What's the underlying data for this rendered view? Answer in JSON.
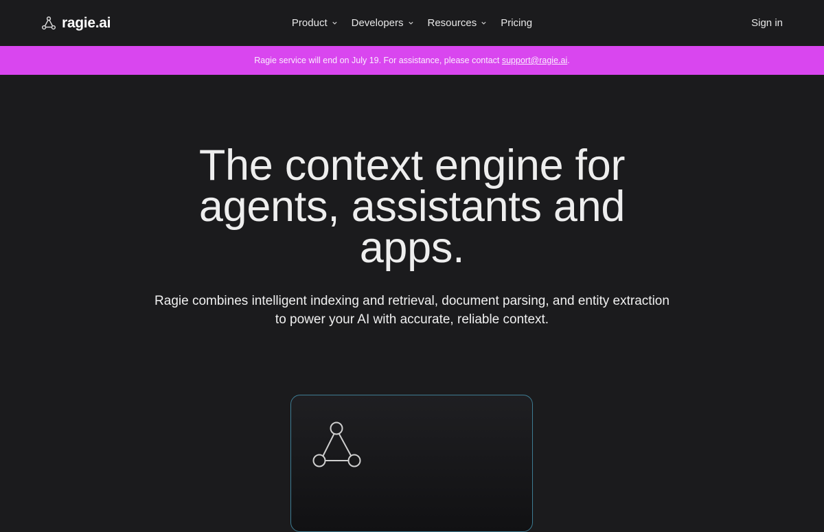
{
  "brand": {
    "name": "ragie.ai"
  },
  "nav": {
    "items": [
      {
        "label": "Product",
        "has_dropdown": true
      },
      {
        "label": "Developers",
        "has_dropdown": true
      },
      {
        "label": "Resources",
        "has_dropdown": true
      },
      {
        "label": "Pricing",
        "has_dropdown": false
      }
    ],
    "signin_label": "Sign in"
  },
  "banner": {
    "text": "Ragie service will end on July 19. For assistance, please contact ",
    "link_text": "support@ragie.ai",
    "suffix": ".",
    "color": "#d946ef"
  },
  "hero": {
    "title": "The context engine for agents, assistants and apps.",
    "subtitle": "Ragie combines intelligent indexing and retrieval, document parsing, and entity extraction to power your AI with accurate, reliable context."
  },
  "card": {
    "icon": "triangle-nodes-icon",
    "border_color": "#3e7d94"
  },
  "colors": {
    "background": "#1b1b1d",
    "accent": "#d946ef"
  }
}
